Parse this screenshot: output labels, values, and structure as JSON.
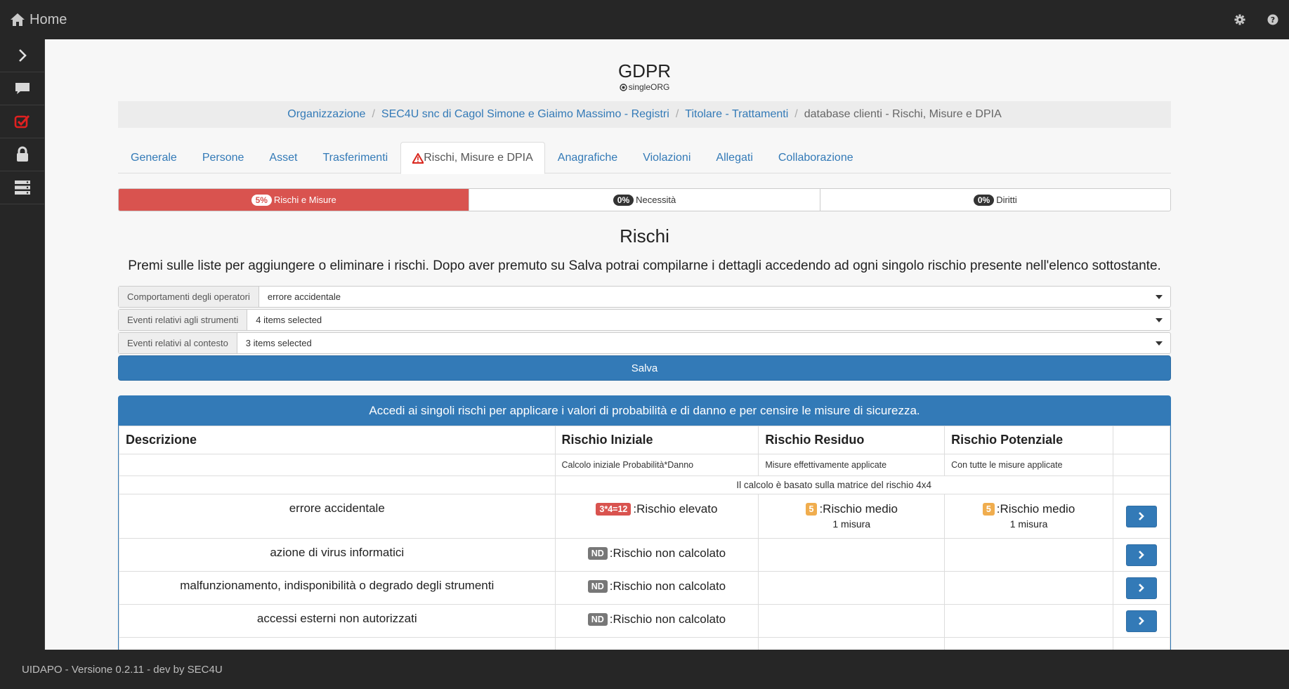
{
  "topbar": {
    "home_label": "Home"
  },
  "sidebar": {
    "items": [
      "chevron-right-icon",
      "comment-icon",
      "checkbox-icon",
      "lock-icon",
      "server-icon"
    ]
  },
  "header": {
    "title": "GDPR",
    "org_mode": "singleORG"
  },
  "breadcrumb": {
    "items": [
      "Organizzazione",
      "SEC4U snc di Cagol Simone e Giaimo Massimo - Registri",
      "Titolare - Trattamenti"
    ],
    "current": "database clienti - Rischi, Misure e DPIA"
  },
  "tabs": [
    "Generale",
    "Persone",
    "Asset",
    "Trasferimenti",
    "Rischi, Misure e DPIA",
    "Anagrafiche",
    "Violazioni",
    "Allegati",
    "Collaborazione"
  ],
  "progress": [
    {
      "percent": "5%",
      "label": "Rischi e Misure"
    },
    {
      "percent": "0%",
      "label": "Necessità"
    },
    {
      "percent": "0%",
      "label": "Diritti"
    }
  ],
  "rischi": {
    "title": "Rischi",
    "intro": "Premi sulle liste per aggiungere o eliminare i rischi. Dopo aver premuto su Salva potrai compilarne i dettagli accedendo ad ogni singolo rischio presente nell'elenco sottostante.",
    "fields": [
      {
        "label": "Comportamenti degli operatori",
        "value": "errore accidentale"
      },
      {
        "label": "Eventi relativi agli strumenti",
        "value": "4 items selected"
      },
      {
        "label": "Eventi relativi al contesto",
        "value": "3 items selected"
      }
    ],
    "save_label": "Salva"
  },
  "table": {
    "heading": "Accedi ai singoli rischi per applicare i valori di probabilità e di danno e per censire le misure di sicurezza.",
    "columns": [
      "Descrizione",
      "Rischio Iniziale",
      "Rischio Residuo",
      "Rischio Potenziale"
    ],
    "subheaders": [
      "Calcolo iniziale Probabilità*Danno",
      "Misure effettivamente applicate",
      "Con tutte le misure applicate"
    ],
    "note": "Il calcolo è basato sulla matrice del rischio 4x4",
    "rows": [
      {
        "desc": "errore accidentale",
        "initial_badge": "3*4=12",
        "initial_text": ":Rischio elevato",
        "residual_badge": "5",
        "residual_text": ":Rischio medio",
        "residual_count": "1 misura",
        "potential_badge": "5",
        "potential_text": ":Rischio medio",
        "potential_count": "1 misura"
      },
      {
        "desc": "azione di virus informatici",
        "initial_badge": "ND",
        "initial_text": ":Rischio non calcolato"
      },
      {
        "desc": "malfunzionamento, indisponibilità o degrado degli strumenti",
        "initial_badge": "ND",
        "initial_text": ":Rischio non calcolato"
      },
      {
        "desc": "accessi esterni non autorizzati",
        "initial_badge": "ND",
        "initial_text": ":Rischio non calcolato"
      }
    ]
  },
  "footer": {
    "text": "UIDAPO - Versione 0.2.11 - dev by SEC4U"
  },
  "colors": {
    "primary": "#337ab7",
    "danger": "#d9534f",
    "warning": "#f0ad4e",
    "dark": "#262626"
  }
}
